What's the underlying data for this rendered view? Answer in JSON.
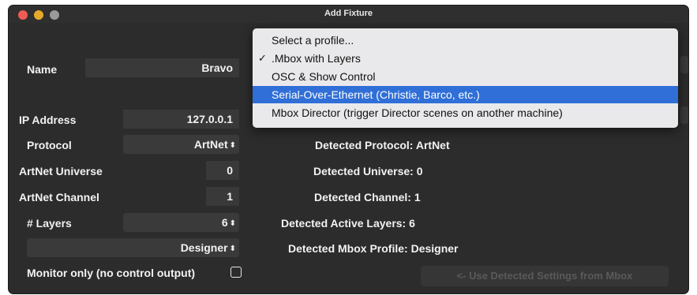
{
  "window": {
    "title": "Add Fixture"
  },
  "form": {
    "name_label": "Name",
    "name_value": "Bravo",
    "ip_label": "IP Address",
    "ip_value": "127.0.0.1",
    "protocol_label": "Protocol",
    "protocol_value": "ArtNet",
    "universe_label": "ArtNet Universe",
    "universe_value": "0",
    "channel_label": "ArtNet Channel",
    "channel_value": "1",
    "layers_label": "# Layers",
    "layers_value": "6",
    "profile_value": "Designer",
    "monitor_label": "Monitor only (no control output)",
    "monitor_checked": false
  },
  "popup_arrows": "⬍",
  "detected": {
    "protocol_label": "Detected Protocol:",
    "protocol_value": "ArtNet",
    "universe_label": "Detected Universe:",
    "universe_value": "0",
    "channel_label": "Detected Channel:",
    "channel_value": "1",
    "layers_label": "Detected Active Layers:",
    "layers_value": "6",
    "profile_label": "Detected Mbox Profile:",
    "profile_value": "Designer"
  },
  "use_detected_button": "<- Use Detected Settings from Mbox",
  "profile_menu": {
    "items": [
      {
        "label": "Select a profile...",
        "checked": false,
        "highlighted": false
      },
      {
        "label": ".Mbox with Layers",
        "checked": true,
        "highlighted": false
      },
      {
        "label": "OSC & Show Control",
        "checked": false,
        "highlighted": false
      },
      {
        "label": "Serial-Over-Ethernet (Christie, Barco, etc.)",
        "checked": false,
        "highlighted": true
      },
      {
        "label": "Mbox Director (trigger Director scenes on another machine)",
        "checked": false,
        "highlighted": false
      }
    ],
    "check_glyph": "✓"
  },
  "colors": {
    "window_bg": "#2c2c2c",
    "menu_highlight": "#2f6fd7"
  }
}
